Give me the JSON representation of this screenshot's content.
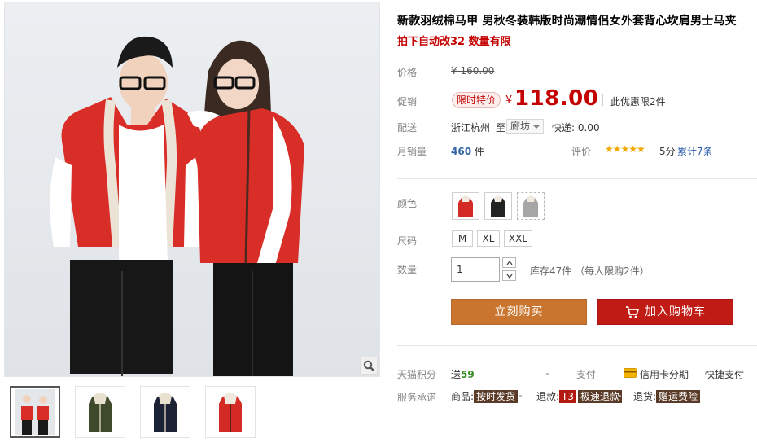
{
  "product": {
    "title": "新款羽绒棉马甲 男秋冬装韩版时尚潮情侣女外套背心坎肩男士马夹",
    "subtitle": "拍下自动改32 数量有限"
  },
  "price": {
    "label": "价格",
    "original": "¥ 160.00",
    "promo_label": "促销",
    "promo_badge": "限时特价",
    "currency": "¥",
    "current": "118.00",
    "promo_limit": "此优惠限2件"
  },
  "shipping": {
    "label": "配送",
    "origin": "浙江杭州",
    "to": "至",
    "destination": "廊坊",
    "fee": "快递: 0.00"
  },
  "sales": {
    "label": "月销量",
    "count": "460",
    "unit": "件",
    "rating_label": "评价",
    "stars": "★★★★★",
    "score": "5分",
    "cumulative": "累计7条"
  },
  "options": {
    "color_label": "颜色",
    "colors": [
      {
        "name": "red-vest",
        "color": "#d42a26"
      },
      {
        "name": "black-vest",
        "color": "#222222"
      },
      {
        "name": "gray-vest",
        "color": "#a6a6a6"
      }
    ],
    "size_label": "尺码",
    "sizes": [
      "M",
      "XL",
      "XXL"
    ],
    "quantity_label": "数量",
    "quantity_value": "1",
    "stock": "库存47件 （每人限购2件）"
  },
  "actions": {
    "buy_now": "立刻购买",
    "add_to_cart": "加入购物车"
  },
  "extras": {
    "points_label": "天猫积分",
    "points_prefix": "送",
    "points_value": "59",
    "pay_label": "支付",
    "credit_card": "信用卡分期",
    "quick_pay": "快捷支付",
    "service_label": "服务承诺",
    "goods_label": "商品:",
    "goods_tag": "按时发货",
    "refund_label": "退款:",
    "refund_t3": "T3",
    "refund_tag": "极速退款",
    "return_label": "退货:",
    "return_tag": "赠运费险"
  },
  "colors": {
    "price_red": "#c40000",
    "buy_orange": "#c9752f",
    "cart_red": "#c11b16"
  }
}
